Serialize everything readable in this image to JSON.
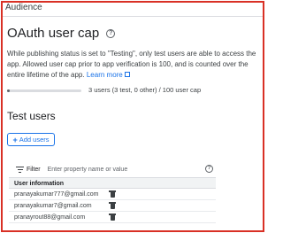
{
  "header": {
    "title": "Audience"
  },
  "oauth": {
    "title": "OAuth user cap",
    "description_pre": "While publishing status is set to \"Testing\", only test users are able to access the app. Allowed user cap prior to app verification is 100, and is counted over the entire lifetime of the app.",
    "learn_more": "Learn more",
    "progress_label": "3 users (3 test, 0 other) / 100 user cap",
    "progress_fraction": 0.03
  },
  "test_users": {
    "title": "Test users",
    "add_label": "Add users",
    "filter_label": "Filter",
    "filter_placeholder": "Enter property name or value",
    "column_header": "User information",
    "rows": [
      {
        "email": "pranayakumar777@gmail.com"
      },
      {
        "email": "pranayakumar7@gmail.com"
      },
      {
        "email": "pranayrout88@gmail.com"
      }
    ]
  },
  "colors": {
    "accent": "#1a73e8",
    "highlight_border": "#d93025"
  },
  "icons": {
    "help": "help-circle-icon",
    "external": "external-link-icon",
    "add": "plus-icon",
    "filter": "filter-icon",
    "delete": "trash-icon"
  }
}
